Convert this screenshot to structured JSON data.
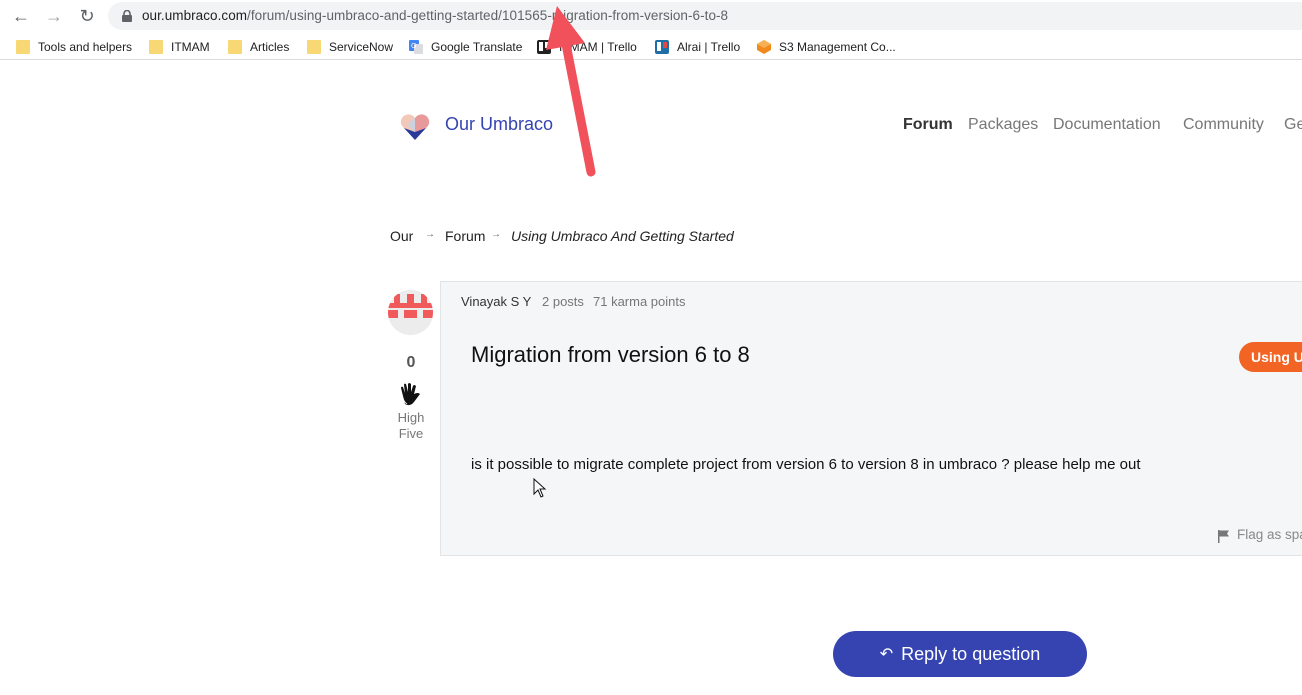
{
  "browser": {
    "url_host": "our.umbraco.com",
    "url_path": "/forum/using-umbraco-and-getting-started/101565-migration-from-version-6-to-8",
    "bookmarks": [
      {
        "label": "Tools and helpers",
        "icon": "folder-icon"
      },
      {
        "label": "ITMAM",
        "icon": "folder-icon"
      },
      {
        "label": "Articles",
        "icon": "folder-icon"
      },
      {
        "label": "ServiceNow",
        "icon": "folder-icon"
      },
      {
        "label": "Google Translate",
        "icon": "google-translate-icon"
      },
      {
        "label": "ITMAM | Trello",
        "icon": "trello-icon"
      },
      {
        "label": "Alrai | Trello",
        "icon": "trello-icon"
      },
      {
        "label": "S3 Management Co...",
        "icon": "aws-icon"
      }
    ]
  },
  "site": {
    "title": "Our Umbraco",
    "nav": [
      "Forum",
      "Packages",
      "Documentation",
      "Community",
      "Ge"
    ]
  },
  "breadcrumb": {
    "items": [
      "Our",
      "Forum",
      "Using Umbraco And Getting Started"
    ]
  },
  "post": {
    "author": "Vinayak S Y",
    "posts": "2 posts",
    "karma": "71 karma points",
    "title": "Migration from version 6 to 8",
    "category": "Using U",
    "body": "is it possible to migrate complete project from version 6 to version 8 in umbraco ? please help me out",
    "flag_label": "Flag as spa",
    "high_five_count": "0",
    "high_five_label": "High Five"
  },
  "actions": {
    "reply_label": "Reply to question"
  },
  "colors": {
    "brand_blue": "#3544b1",
    "category_orange": "#f26423",
    "annotation_arrow": "#f0515a"
  }
}
